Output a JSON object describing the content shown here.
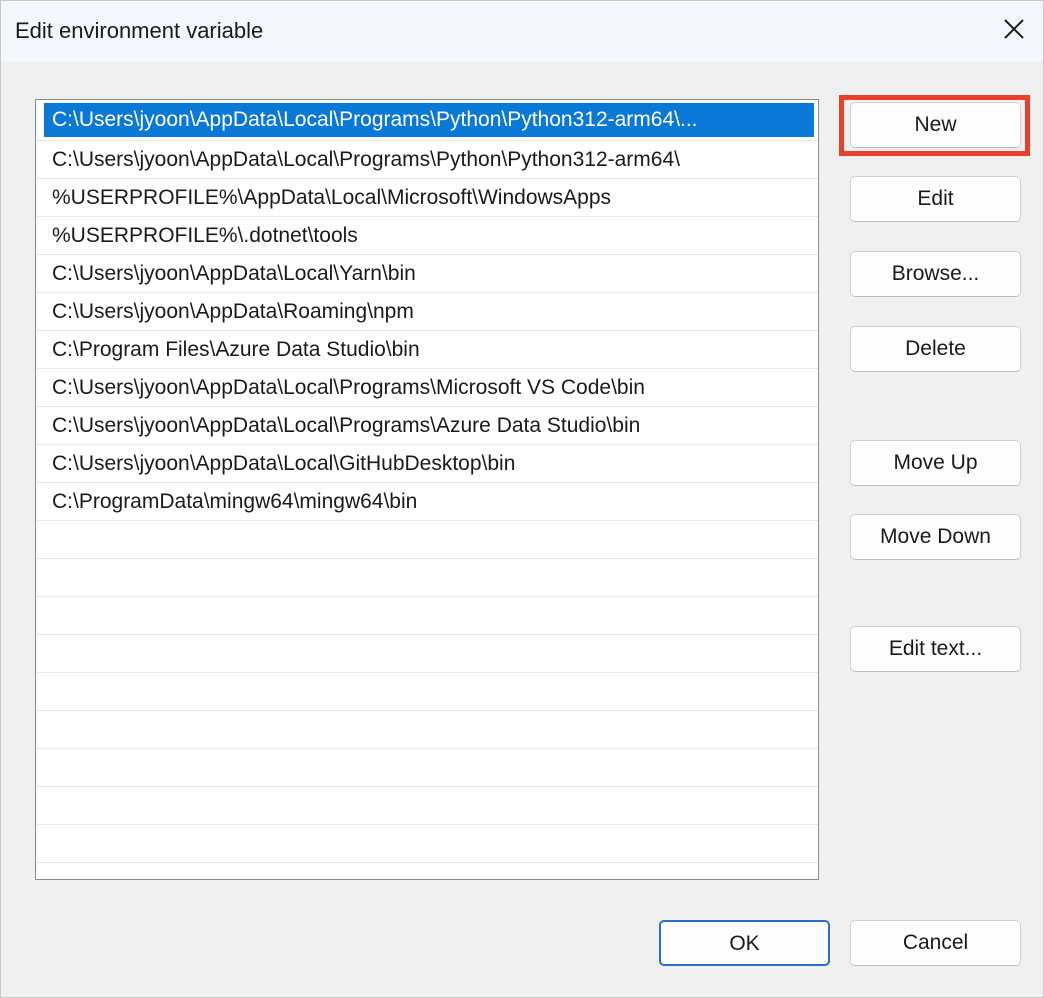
{
  "window": {
    "title": "Edit environment variable"
  },
  "list": {
    "items": [
      "C:\\Users\\jyoon\\AppData\\Local\\Programs\\Python\\Python312-arm64\\...",
      "C:\\Users\\jyoon\\AppData\\Local\\Programs\\Python\\Python312-arm64\\",
      "%USERPROFILE%\\AppData\\Local\\Microsoft\\WindowsApps",
      "%USERPROFILE%\\.dotnet\\tools",
      "C:\\Users\\jyoon\\AppData\\Local\\Yarn\\bin",
      "C:\\Users\\jyoon\\AppData\\Roaming\\npm",
      "C:\\Program Files\\Azure Data Studio\\bin",
      "C:\\Users\\jyoon\\AppData\\Local\\Programs\\Microsoft VS Code\\bin",
      "C:\\Users\\jyoon\\AppData\\Local\\Programs\\Azure Data Studio\\bin",
      "C:\\Users\\jyoon\\AppData\\Local\\GitHubDesktop\\bin",
      "C:\\ProgramData\\mingw64\\mingw64\\bin"
    ]
  },
  "buttons": {
    "new": "New",
    "edit": "Edit",
    "browse": "Browse...",
    "delete": "Delete",
    "move_up": "Move Up",
    "move_down": "Move Down",
    "edit_text": "Edit text...",
    "ok": "OK",
    "cancel": "Cancel"
  },
  "colors": {
    "selection": "#0a78d7",
    "highlight": "#e8402a"
  }
}
